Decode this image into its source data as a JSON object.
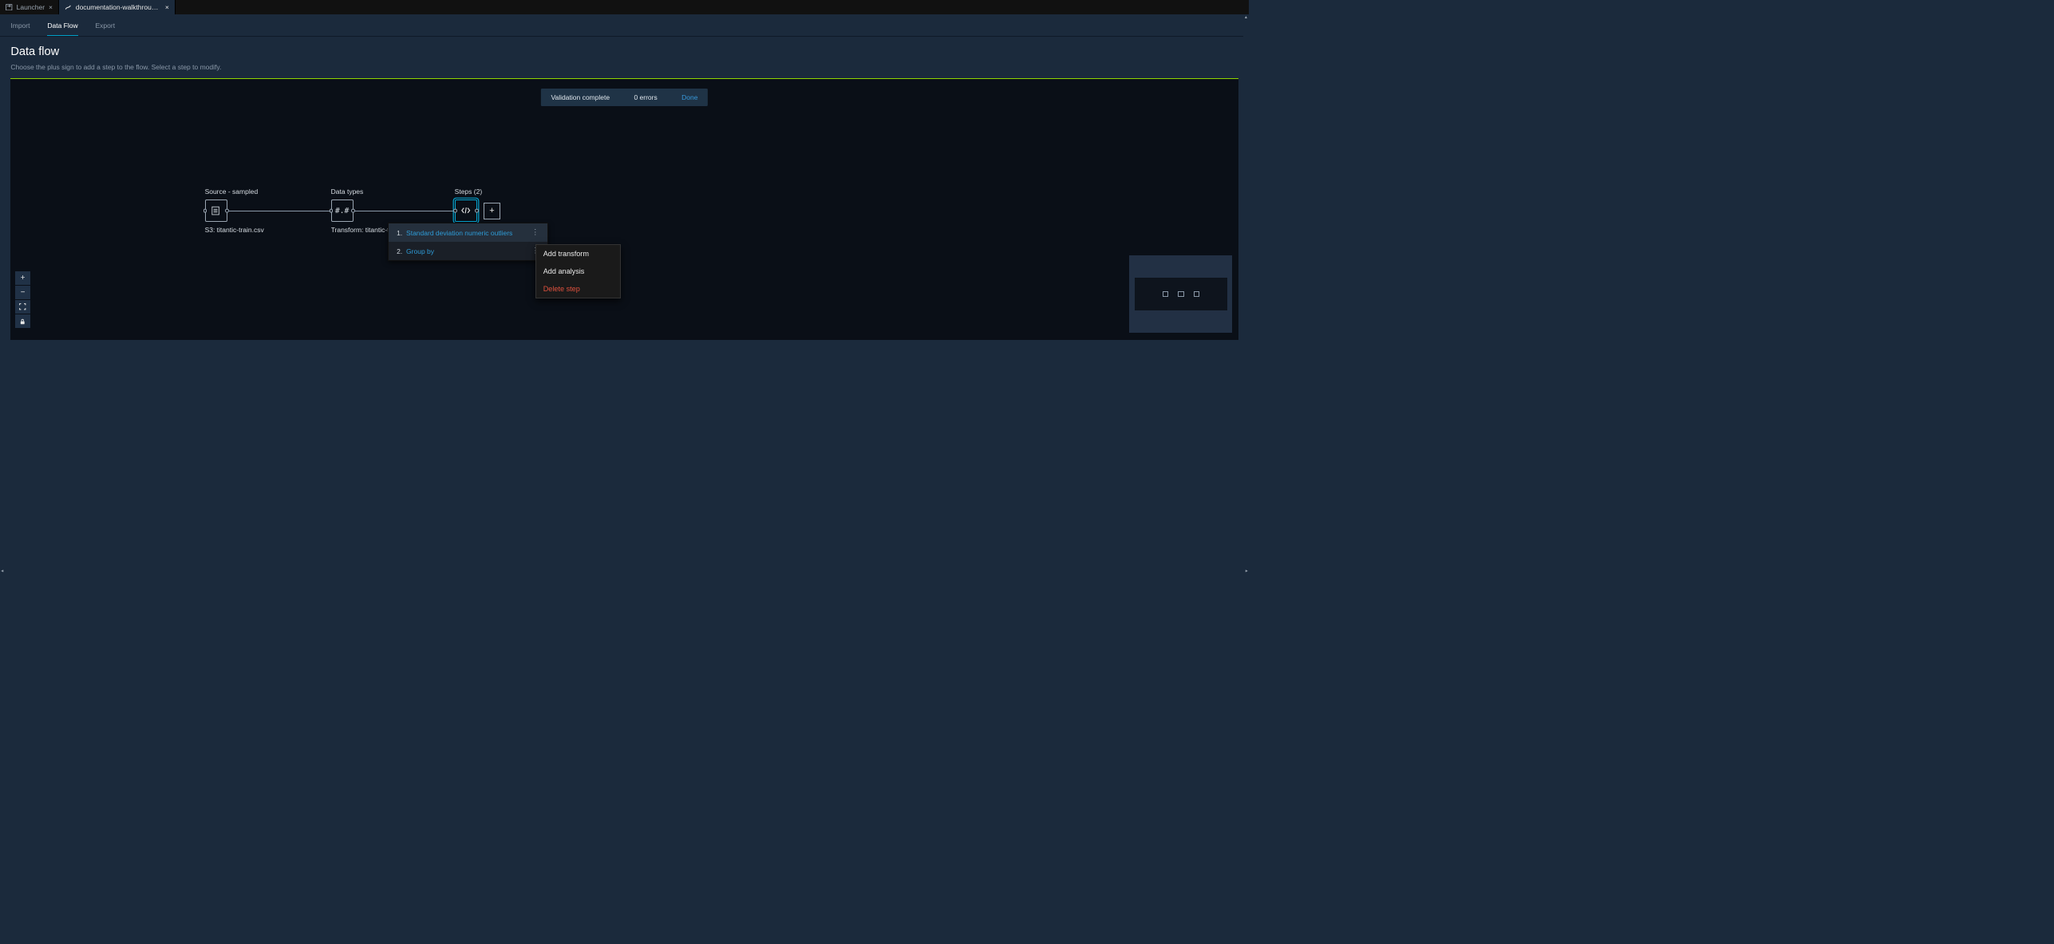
{
  "ideTabs": [
    {
      "label": "Launcher",
      "active": false
    },
    {
      "label": "documentation-walkthrough-",
      "active": true
    }
  ],
  "sectionTabs": {
    "import": "Import",
    "dataflow": "Data Flow",
    "export": "Export",
    "active": "dataflow"
  },
  "header": {
    "title": "Data flow",
    "subtitle": "Choose the plus sign to add a step to the flow. Select a step to modify."
  },
  "toast": {
    "status": "Validation complete",
    "errors": "0 errors",
    "done": "Done"
  },
  "nodes": {
    "source": {
      "topLabel": "Source - sampled",
      "bottomLabel": "S3: titantic-train.csv"
    },
    "types": {
      "topLabel": "Data types",
      "glyph": "#.#",
      "bottomLabel": "Transform: titantic-t"
    },
    "steps": {
      "topLabel": "Steps (2)"
    }
  },
  "stepsPopover": [
    {
      "num": "1.",
      "name": "Standard deviation numeric outliers",
      "highlighted": true
    },
    {
      "num": "2.",
      "name": "Group by",
      "highlighted": false
    }
  ],
  "contextMenu": {
    "addTransform": "Add transform",
    "addAnalysis": "Add analysis",
    "deleteStep": "Delete step"
  },
  "canvasControls": {
    "zoomIn": "+",
    "zoomOut": "−"
  },
  "plusGlyph": "+",
  "icons": {
    "launcher": "launcher-icon",
    "flowfile": "flow-file-icon"
  }
}
